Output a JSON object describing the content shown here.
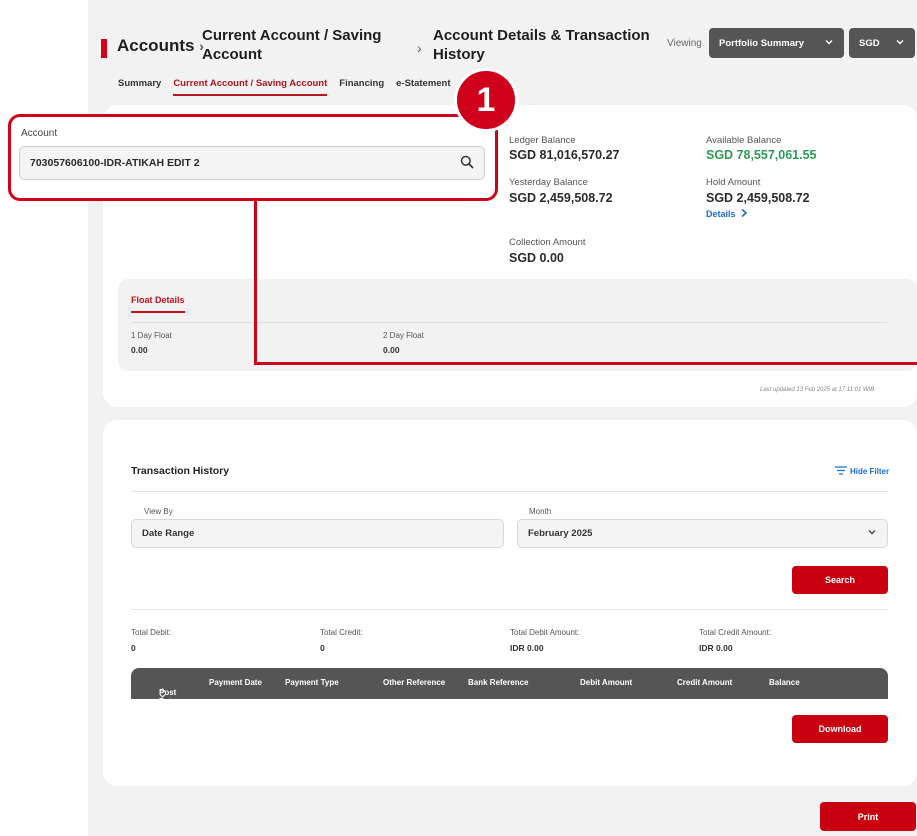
{
  "breadcrumb": {
    "level1": "Accounts",
    "sep": "›",
    "level2": "Current Account / Saving Account",
    "level3": "Account Details & Transaction History"
  },
  "header": {
    "viewing_label": "Viewing",
    "portfolio_value": "Portfolio Summary",
    "currency_value": "SGD"
  },
  "tabs": [
    {
      "label": "Summary",
      "active": false
    },
    {
      "label": "Current Account / Saving Account",
      "active": true
    },
    {
      "label": "Financing",
      "active": false
    },
    {
      "label": "e-Statement",
      "active": false
    }
  ],
  "account": {
    "label": "Account",
    "value": "703057606100-IDR-ATIKAH EDIT 2"
  },
  "balances": {
    "ledger_label": "Ledger Balance",
    "ledger_value": "SGD 81,016,570.27",
    "available_label": "Available Balance",
    "available_value": "SGD 78,557,061.55",
    "yesterday_label": "Yesterday Balance",
    "yesterday_value": "SGD 2,459,508.72",
    "hold_label": "Hold Amount",
    "hold_value": "SGD 2,459,508.72",
    "details_link": "Details",
    "collection_label": "Collection Amount",
    "collection_value": "SGD 0.00"
  },
  "float": {
    "title": "Float Details",
    "day1_label": "1 Day Float",
    "day1_value": "0.00",
    "day2_label": "2 Day Float",
    "day2_value": "0.00"
  },
  "last_updated": "Last updated 13 Feb 2025 at 17:11:01 WIB",
  "transactions": {
    "title": "Transaction History",
    "hide_filter": "Hide Filter",
    "view_by_label": "View By",
    "view_by_value": "Date Range",
    "month_label": "Month",
    "month_value": "February 2025",
    "search_button": "Search",
    "total_debit_label": "Total Debit:",
    "total_debit_value": "0",
    "total_credit_label": "Total Credit:",
    "total_credit_value": "0",
    "total_debit_amount_label": "Total Debit Amount:",
    "total_debit_amount_value": "IDR 0.00",
    "total_credit_amount_label": "Total Credit Amount:",
    "total_credit_amount_value": "IDR 0.00",
    "columns": [
      "Post Date",
      "Payment Date",
      "Payment Type",
      "Other Reference",
      "Bank Reference",
      "Debit Amount",
      "Credit Amount",
      "Balance"
    ],
    "download_button": "Download"
  },
  "print_button": "Print",
  "step_number": "1",
  "colors": {
    "accent_red": "#d0021b",
    "available_green": "#2e9a57",
    "link_blue": "#1a6fd1",
    "dark_select": "#555555"
  }
}
